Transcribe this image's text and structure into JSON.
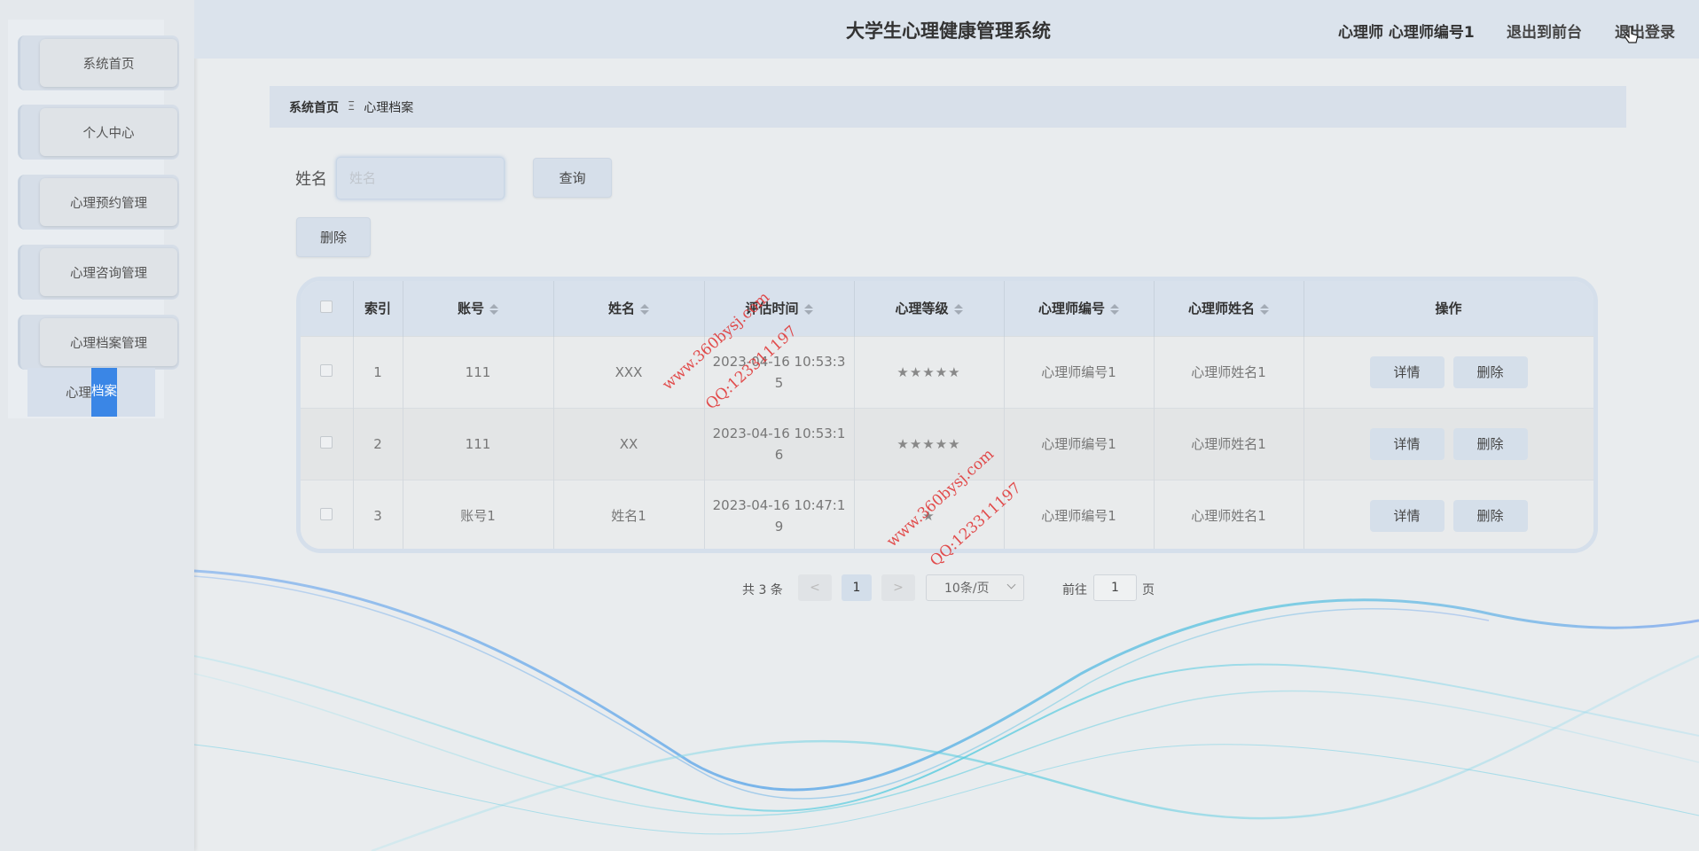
{
  "sidebar": {
    "items": [
      {
        "label": "系统首页"
      },
      {
        "label": "个人中心"
      },
      {
        "label": "心理预约管理"
      },
      {
        "label": "心理咨询管理"
      },
      {
        "label": "心理档案管理"
      }
    ],
    "sub_item": {
      "label_a": "心理",
      "label_b": "档案"
    }
  },
  "header": {
    "title": "大学生心理健康管理系统",
    "user": "心理师 心理师编号1",
    "front_link": "退出到前台",
    "logout_link": "退出登录"
  },
  "breadcrumb": {
    "home": "系统首页",
    "separator": "Ξ",
    "current": "心理档案"
  },
  "search": {
    "label": "姓名",
    "placeholder": "姓名",
    "button": "查询"
  },
  "actions": {
    "delete_button": "删除"
  },
  "table": {
    "headers": [
      "索引",
      "账号",
      "姓名",
      "评估时间",
      "心理等级",
      "心理师编号",
      "心理师姓名",
      "操作"
    ],
    "rows": [
      {
        "index": "1",
        "account": "111",
        "name": "XXX",
        "time_a": "2023-04-16 10:53:3",
        "time_b": "5",
        "level": "★★★★★",
        "psy_id": "心理师编号1",
        "psy_name": "心理师姓名1"
      },
      {
        "index": "2",
        "account": "111",
        "name": "XX",
        "time_a": "2023-04-16 10:53:1",
        "time_b": "6",
        "level": "★★★★★",
        "psy_id": "心理师编号1",
        "psy_name": "心理师姓名1"
      },
      {
        "index": "3",
        "account": "账号1",
        "name": "姓名1",
        "time_a": "2023-04-16 10:47:1",
        "time_b": "9",
        "level": "★",
        "psy_id": "心理师编号1",
        "psy_name": "心理师姓名1"
      }
    ],
    "detail_button": "详情",
    "row_delete_button": "删除"
  },
  "pagination": {
    "total": "共 3 条",
    "prev": "<",
    "current_page": "1",
    "next": ">",
    "page_size": "10条/页",
    "goto_label": "前往",
    "goto_value": "1",
    "page_suffix": "页"
  },
  "watermark": {
    "site": "www.360bysj.com",
    "qq": "QQ:123311197"
  },
  "colors": {
    "accent": "#3a86e6",
    "panel": "#d8e1ec",
    "watermark": "#e03030"
  }
}
